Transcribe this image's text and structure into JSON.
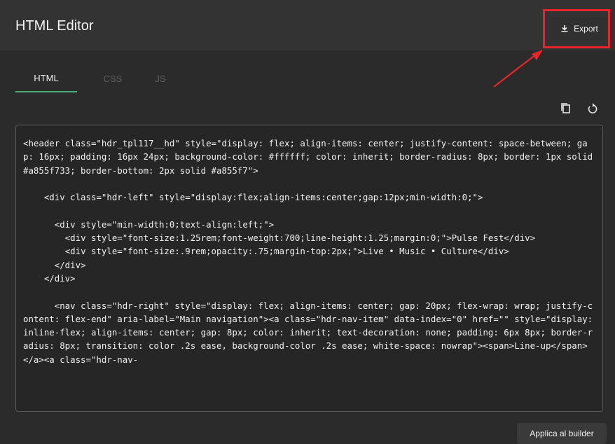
{
  "header": {
    "title": "HTML Editor",
    "export_label": "Export"
  },
  "tabs": [
    {
      "label": "HTML",
      "active": true
    },
    {
      "label": "CSS",
      "active": false
    },
    {
      "label": "JS",
      "active": false
    }
  ],
  "toolbar": {
    "copy_icon": "copy-icon",
    "reset_icon": "reset-icon"
  },
  "editor": {
    "code": "<header class=\"hdr_tpl117__hd\" style=\"display: flex; align-items: center; justify-content: space-between; gap: 16px; padding: 16px 24px; background-color: #ffffff; color: inherit; border-radius: 8px; border: 1px solid #a855f733; border-bottom: 2px solid #a855f7\">\n\n    <div class=\"hdr-left\" style=\"display:flex;align-items:center;gap:12px;min-width:0;\">\n\n      <div style=\"min-width:0;text-align:left;\">\n        <div style=\"font-size:1.25rem;font-weight:700;line-height:1.25;margin:0;\">Pulse Fest</div>\n        <div style=\"font-size:.9rem;opacity:.75;margin-top:2px;\">Live • Music • Culture</div>\n      </div>\n    </div>\n\n      <nav class=\"hdr-right\" style=\"display: flex; align-items: center; gap: 20px; flex-wrap: wrap; justify-content: flex-end\" aria-label=\"Main navigation\"><a class=\"hdr-nav-item\" data-index=\"0\" href=\"\" style=\"display: inline-flex; align-items: center; gap: 8px; color: inherit; text-decoration: none; padding: 6px 8px; border-radius: 8px; transition: color .2s ease, background-color .2s ease; white-space: nowrap\"><span>Line-up</span></a><a class=\"hdr-nav-"
  },
  "footer": {
    "apply_label": "Applica al builder"
  },
  "colors": {
    "highlight": "#e8252a",
    "active_tab": "#4caf79",
    "background": "#2b2b2b"
  }
}
